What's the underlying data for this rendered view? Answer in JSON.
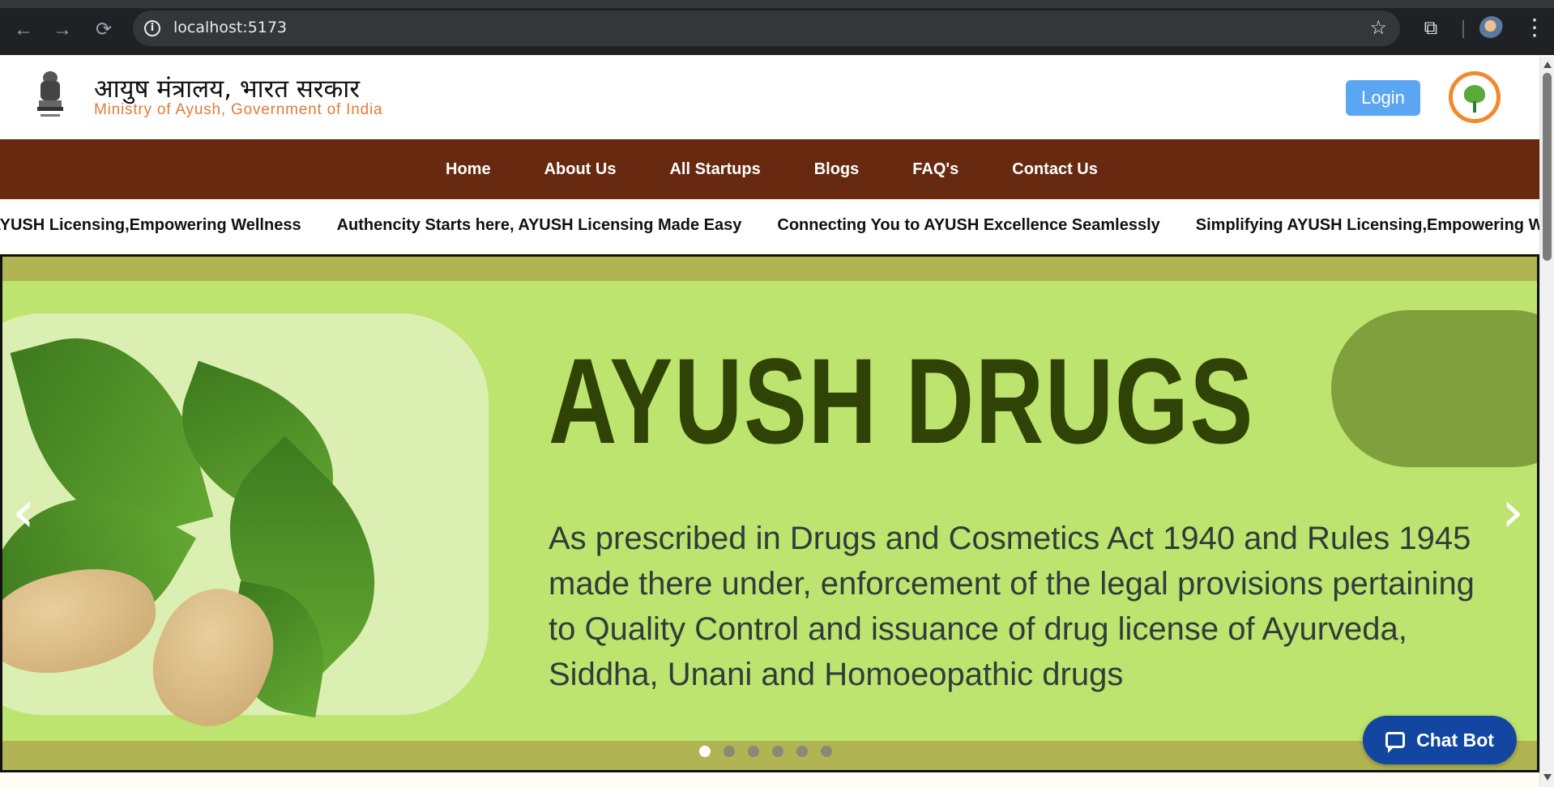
{
  "browser": {
    "url": "localhost:5173",
    "back_glyph": "←",
    "forward_glyph": "→",
    "reload_glyph": "⟳",
    "info_glyph": "i",
    "star_glyph": "☆",
    "extensions_glyph": "⧉",
    "menu_glyph": "⋮"
  },
  "header": {
    "title_hindi": "आयुष मंत्रालय, भारत सरकार",
    "title_english": "Ministry of Ayush, Government of India",
    "login_label": "Login",
    "accent_color": "#e47a38"
  },
  "nav": {
    "items": [
      {
        "label": "Home"
      },
      {
        "label": "About Us"
      },
      {
        "label": "All Startups"
      },
      {
        "label": "Blogs"
      },
      {
        "label": "FAQ's"
      },
      {
        "label": "Contact Us"
      }
    ],
    "background": "#672a10"
  },
  "marquee": {
    "items": [
      "g AYUSH Licensing,Empowering Wellness",
      "Authencity Starts here, AYUSH Licensing Made Easy",
      "Connecting You to AYUSH Excellence Seamlessly",
      "Simplifying AYUSH Licensing,Empowering W"
    ]
  },
  "slider": {
    "title": "AYUSH DRUGS",
    "description": "As prescribed in Drugs and Cosmetics Act 1940 and Rules 1945 made there under, enforcement of the legal provisions pertaining to Quality Control and issuance of drug license of Ayurveda, Siddha, Unani and Homoeopathic drugs",
    "prev_glyph": "‹",
    "next_glyph": "›",
    "slide_count": 6,
    "active_slide": 1,
    "background": "#bde46f"
  },
  "chatbot": {
    "label": "Chat Bot",
    "color": "#1246a1"
  }
}
